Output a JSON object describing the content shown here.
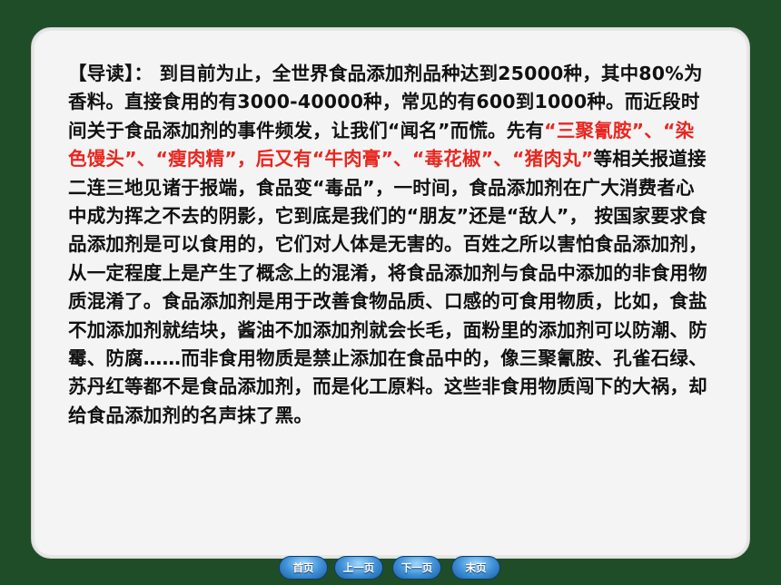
{
  "reading": {
    "segments": [
      {
        "text": "【导读】： 到目前为止，全世界食品添加剂品种达到25000种，其中80%为香料。直接食用的有3000-40000种，常见的有600到1000种。而近段时间关于食品添加剂的事件频发，让我们“闻名”而慌。先有",
        "red": false
      },
      {
        "text": "“三聚氰胺”、“染色馒头”、“瘦肉精”，后又有“牛肉膏”、“毒花椒”、“猪肉丸”",
        "red": true
      },
      {
        "text": "等相关报道接二连三地见诸于报端，食品变“毒品”，一时间，食品添加剂在广大消费者心中成为挥之不去的阴影，它到底是我们的“朋友”还是“敌人”， 按国家要求食品添加剂是可以食用的，它们对人体是无害的。百姓之所以害怕食品添加剂，从一定程度上是产生了概念上的混淆，将食品添加剂与食品中添加的非食用物质混淆了。食品添加剂是用于改善食物品质、口感的可食用物质，比如，食盐不加添加剂就结块，酱油不加添加剂就会长毛，面粉里的添加剂可以防潮、防霉、防腐……而非食用物质是禁止添加在食品中的，像三聚氰胺、孔雀石绿、苏丹红等都不是食品添加剂，而是化工原料。这些非食用物质闯下的大祸，却给食品添加剂的名声抹了黑。",
        "red": false
      }
    ]
  },
  "nav": {
    "home": "首页",
    "prev": "上一页",
    "next": "下一页",
    "last": "末页"
  },
  "colors": {
    "background": "#1f4d28",
    "highlight": "#e8261f",
    "button": "#3d8fd6"
  }
}
